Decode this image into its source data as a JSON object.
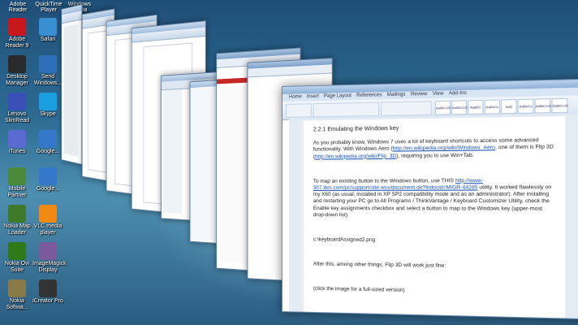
{
  "desktop": {
    "icons": [
      {
        "label": "Adobe Reader 9",
        "icon": "pdf-icon",
        "color": "#c8181e"
      },
      {
        "label": "Safari",
        "icon": "compass-icon",
        "color": "#3a8fd0"
      },
      {
        "label": "Desktop Manager",
        "icon": "phone-icon",
        "color": "#2a2a2a"
      },
      {
        "label": "Send Windows...",
        "icon": "user-icon",
        "color": "#2e6fb8"
      },
      {
        "label": "Lenovo SlimRead",
        "icon": "laptop-icon",
        "color": "#3a4fb8"
      },
      {
        "label": "Skype",
        "icon": "skype-icon",
        "color": "#1aa0e0"
      },
      {
        "label": "iTunes",
        "icon": "music-icon",
        "color": "#5a6ad0"
      },
      {
        "label": "Google...",
        "icon": "globe-icon",
        "color": "#3577c8"
      },
      {
        "label": "Mobile Partner",
        "icon": "gear-icon",
        "color": "#4a8a3a"
      },
      {
        "label": "Google...",
        "icon": "globe-icon",
        "color": "#3577c8"
      },
      {
        "label": "Nokia Map Loader",
        "icon": "map-icon",
        "color": "#3f7a2a"
      },
      {
        "label": "VLC media player",
        "icon": "cone-icon",
        "color": "#f08a12"
      },
      {
        "label": "Nokia Ovi Suite",
        "icon": "ovi-icon",
        "color": "#2e7a18"
      },
      {
        "label": "ImageMagick Display",
        "icon": "image-icon",
        "color": "#7a5a9a"
      },
      {
        "label": "Nokia Softwa...",
        "icon": "folder-icon",
        "color": "#8a7a4a"
      },
      {
        "label": "iCreator Pro",
        "icon": "film-icon",
        "color": "#333333"
      }
    ],
    "top_labels": [
      "Adobe Reader",
      "QuickTime Player",
      "Windows Media"
    ]
  },
  "front_window": {
    "tabs": [
      "Home",
      "Insert",
      "Page Layout",
      "References",
      "Mailings",
      "Review",
      "View",
      "Add-Ins"
    ],
    "styles": [
      "AaBbCcDc",
      "AaBbCcDc",
      "AaBbC",
      "AaBbCc",
      "AaB",
      "AaBbCc",
      "AaBbCcDe",
      "AaBbCcD"
    ],
    "heading": "2.2.1 Emulating the Windows key",
    "para1_a": "As you probably know, Windows 7 uses a lot of  keyboard shortcuts to access some advanced functionality. With Windows Aero (",
    "para1_link1": "http://en.wikipedia.org/wiki/Windows_Aero",
    "para1_b": ", one of them is Flip 3D (",
    "para1_link2": "http://en.wikipedia.org/wiki/Flip_3D",
    "para1_c": "), requiring you to use Win+Tab.",
    "para2_a": "To map an existing button to the Windows button, use THIS ",
    "para2_link": "http://www-307.ibm.com/pc/support/site.wss/document.do?lndocid=MIGR-44285",
    "para2_b": " utility. It worked flawlessly on my X60 (as usual, installed in XP SP2 compatibility mode and as an administrator). After installing and restarting your PC go to All Programs / ThinkVantage / Keyboard Customizer Utility, check the Enable key assignments checkbox and select a button to map to the Windows key (upper-most drop-down list):",
    "path": "c:\\keyboardAssigned2.png",
    "para3": "After this, among other things, Flip 3D will work just fine:",
    "para4": "(click the image for a full-sized version)"
  },
  "colors": {
    "desktop_top": "#1f4f78",
    "desktop_mid": "#4d8fb0",
    "word_blue": "#8fb0d6"
  }
}
